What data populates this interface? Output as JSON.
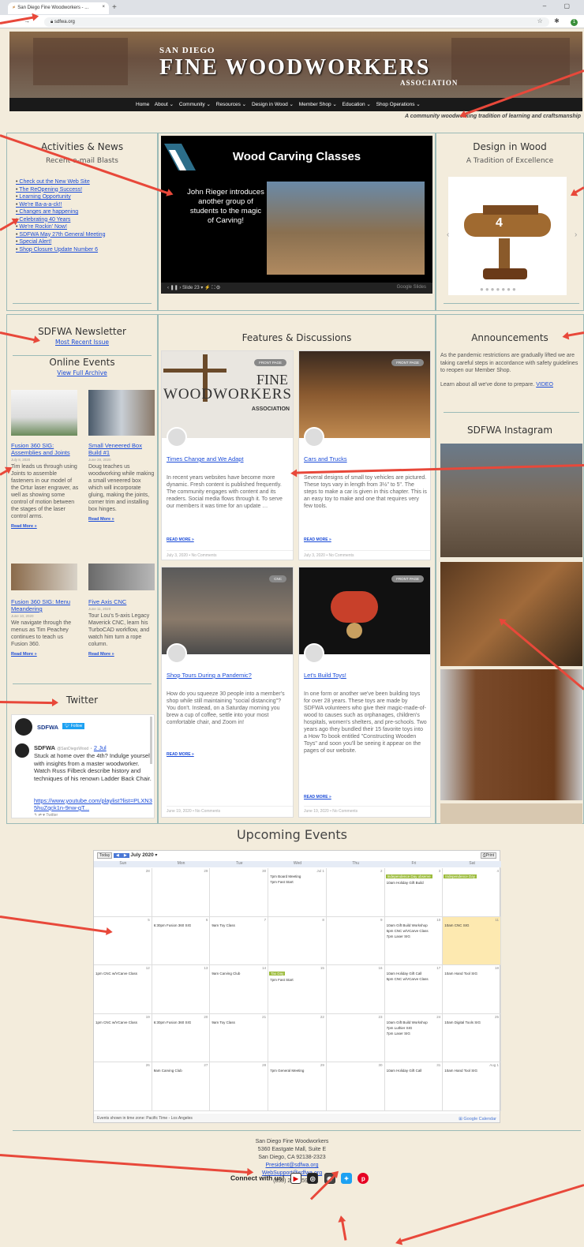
{
  "browser": {
    "tab_title": "San Diego Fine Woodworkers - ...",
    "url": "sdfwa.org",
    "profile_initial": "1"
  },
  "header": {
    "line1": "SAN DIEGO",
    "line2": "FINE WOODWORKERS",
    "line3": "ASSOCIATION",
    "nav": [
      "Home",
      "About ⌄",
      "Community ⌄",
      "Resources ⌄",
      "Design in Wood ⌄",
      "Member Shop ⌄",
      "Education ⌄",
      "Shop Operations ⌄"
    ],
    "tagline": "A community woodworking tradition of learning and craftsmanship"
  },
  "left": {
    "activities_title": "Activities & News",
    "blasts_title": "Recent e-mail Blasts",
    "blasts": [
      "Check out the New Web Site",
      "The ReOpening Success!",
      "Learning Opportunity",
      "We're Ba-a-a-ck!!",
      "Changes are happening",
      "Celebrating 40 Years",
      "We're Rockin' Now!",
      "SDFWA May 27th General Meeting",
      "Special Alert!",
      "Shop Closure Update Number 6"
    ],
    "newsletter_title": "SDFWA Newsletter",
    "newsletter_link": "Most Recent Issue",
    "online_title": "Online Events",
    "online_link": "View Full Archive",
    "events": [
      {
        "title": "Fusion 360 SIG: Assemblies and Joints",
        "date": "July 8, 2020",
        "text": "Tim leads us through using Joints to assemble fasteners in our model of the Ortur laser engraver, as well as showing some control of motion between the stages of the laser control arms.",
        "more": "Read More »"
      },
      {
        "title": "Small Veneered Box Build #1",
        "date": "June 28, 2020",
        "text": "Doug teaches us woodworking while making a small veneered box which will incorporate gluing, making the joints, corner trim and installing box hinges.",
        "more": "Read More »"
      },
      {
        "title": "Fusion 360 SIG: Menu Meandering",
        "date": "June 10, 2020",
        "text": "We navigate through the menus as Tim Peachey continues to teach us Fusion 360.",
        "more": "Read More »"
      },
      {
        "title": "Five Axis CNC",
        "date": "June 11, 2020",
        "text": "Tour Lou's 5-axis Legacy Maverick CNC, learn his TurboCAD workflow, and watch him turn a rope column.",
        "more": "Read More »"
      }
    ],
    "twitter_title": "Twitter",
    "twitter_account": "SDFWA",
    "twitter_follow": "Follow",
    "tweet_name": "SDFWA",
    "tweet_handle": "@SanDiegoWood",
    "tweet_date": "2 Jul",
    "tweet_text": "Stuck at home over the 4th? Indulge yourself with insights from a master woodworker. Watch Russ Filbeck describe history and techniques of his renown Ladder Back Chair.",
    "tweet_link": "https://www.youtube.com/playlist?list=PLXN35huZqck1n-9nw-gT...",
    "tweet_actions": "↰  ⇄  ♥  Twitter"
  },
  "center": {
    "slide_title": "Wood Carving Classes",
    "slide_body": "John Rieger introduces another group of students to the magic of Carving!",
    "slide_controls": "‹   ❚❚   ›    Slide 23   ▾   ⚡  ⛶  ⚙",
    "slide_brand": "Google Slides",
    "features_title": "Features & Discussions",
    "cards": [
      {
        "tag": "FRONT PAGE",
        "title": "Times Change and We Adapt",
        "text": "In recent years websites have become more dynamic. Fresh content is published frequently. The community engages with content and its readers. Social media flows through it. To serve our members it was time for an update …",
        "more": "READ MORE »",
        "footer": "July 3, 2020  •  No Comments",
        "logo1": "FINE",
        "logo2": "WOODWORKERS",
        "logo3": "ASSOCIATION"
      },
      {
        "tag": "FRONT PAGE",
        "title": "Cars and Trucks",
        "text": "Several designs of small toy vehicles are pictured. These toys vary in length from 3½\" to 5\". The steps to make a car is given in this chapter. This is an easy toy to make and one that requires very few tools.",
        "more": "READ MORE »",
        "footer": "July 3, 2020  •  No Comments"
      },
      {
        "tag": "CNC",
        "title": "Shop Tours During a Pandemic?",
        "text": "How do you squeeze 30 people into a member's shop while still maintaining \"social distancing\"? You don't. Instead, on a Saturday morning you brew a cup of coffee, settle into your most comfortable chair, and Zoom in!",
        "more": "READ MORE »",
        "footer": "June 19, 2020  •  No Comments"
      },
      {
        "tag": "FRONT PAGE",
        "title": "Let's Build Toys!",
        "text": "In one form or another we've been building toys for over 28 years. These toys are made by SDFWA volunteers who give their magic-made-of-wood to causes such as orphanages, children's hospitals, women's shelters, and pre-schools. Two years ago they bundled their 15 favorite toys into a How To book entitled \"Constructing Wooden Toys\" and soon you'll be seeing it appear on the pages of our website.",
        "more": "READ MORE »",
        "footer": "June 19, 2020  •  No Comments"
      }
    ]
  },
  "right": {
    "design_title": "Design in Wood",
    "design_sub": "A Tradition of Excellence",
    "plane_number": "4",
    "announce_title": "Announcements",
    "announce_text": "As the pandemic restrictions are gradually lifted we are taking careful steps in accordance with safety guidelines to reopen our Member Shop.",
    "announce_text2": "Learn about all we've done to prepare.",
    "announce_link": "VIDEO",
    "insta_title": "SDFWA Instagram"
  },
  "calendar": {
    "title": "Upcoming Events",
    "today": "Today",
    "month": "July 2020",
    "print": "Print",
    "days": [
      "Sun",
      "Mon",
      "Tue",
      "Wed",
      "Thu",
      "Fri",
      "Sat"
    ],
    "weeks": [
      [
        {
          "d": "28",
          "e": []
        },
        {
          "d": "29",
          "e": []
        },
        {
          "d": "30",
          "e": []
        },
        {
          "d": "Jul 1",
          "e": [
            "7pm Board Meeting",
            "7pm Fast Start"
          ]
        },
        {
          "d": "2",
          "e": []
        },
        {
          "d": "3",
          "e": [
            "10am Holiday Gift Build"
          ],
          "b": "Independence Day observe"
        },
        {
          "d": "4",
          "e": [],
          "b": "Independence Day"
        }
      ],
      [
        {
          "d": "5",
          "e": []
        },
        {
          "d": "6",
          "e": [
            "6:30pm Fusion 360 SIG"
          ]
        },
        {
          "d": "7",
          "e": [
            "9am Toy Class"
          ]
        },
        {
          "d": "8",
          "e": []
        },
        {
          "d": "9",
          "e": []
        },
        {
          "d": "10",
          "e": [
            "10am Gift Build Workshop",
            "5pm CNC w/VCarve Class",
            "7pm Laser SIG"
          ]
        },
        {
          "d": "11",
          "e": [
            "10am CNC SIG"
          ],
          "hl": true
        }
      ],
      [
        {
          "d": "12",
          "e": [
            "1pm CNC w/VCarve Class"
          ]
        },
        {
          "d": "13",
          "e": []
        },
        {
          "d": "14",
          "e": [
            "9am Carving Club"
          ]
        },
        {
          "d": "15",
          "e": [
            "7pm Fast Start"
          ],
          "b": "Tax Day"
        },
        {
          "d": "16",
          "e": []
        },
        {
          "d": "17",
          "e": [
            "10am Holiday Gift Call",
            "5pm CNC w/VCarve Class"
          ]
        },
        {
          "d": "18",
          "e": [
            "10am Hand Tool SIG"
          ]
        }
      ],
      [
        {
          "d": "19",
          "e": [
            "1pm CNC w/VCarve Class"
          ]
        },
        {
          "d": "20",
          "e": [
            "6:30pm Fusion 360 SIG"
          ]
        },
        {
          "d": "21",
          "e": [
            "9am Toy Class"
          ]
        },
        {
          "d": "22",
          "e": []
        },
        {
          "d": "23",
          "e": []
        },
        {
          "d": "24",
          "e": [
            "10am Gift Build Workshop",
            "7pm Luthier SIG",
            "7pm Laser SIG"
          ]
        },
        {
          "d": "25",
          "e": [
            "10am Digital Tools SIG"
          ]
        }
      ],
      [
        {
          "d": "26",
          "e": []
        },
        {
          "d": "27",
          "e": [
            "9am Carving Club"
          ]
        },
        {
          "d": "28",
          "e": []
        },
        {
          "d": "29",
          "e": [
            "7pm General Meeting"
          ]
        },
        {
          "d": "30",
          "e": []
        },
        {
          "d": "31",
          "e": [
            "10am Holiday Gift Call"
          ]
        },
        {
          "d": "Aug 1",
          "e": [
            "10am Hand Tool SIG"
          ]
        }
      ]
    ],
    "timezone": "Events shown in time zone: Pacific Time - Los Angeles",
    "gcal": "Google Calendar"
  },
  "footer": {
    "org": "San Diego Fine Woodworkers",
    "addr1": "5360 Eastgate Mall, Suite E",
    "addr2": "San Diego, CA 92138-2323",
    "email1": "President@sdfwa.org",
    "email2": "WebSupport@sdfwa.org",
    "phone": "(858) 230-7593",
    "connect": "Connect with us!"
  },
  "colors": {
    "arrow": "#e8483a",
    "link": "#1a4bd8",
    "border": "#9bbab7"
  }
}
